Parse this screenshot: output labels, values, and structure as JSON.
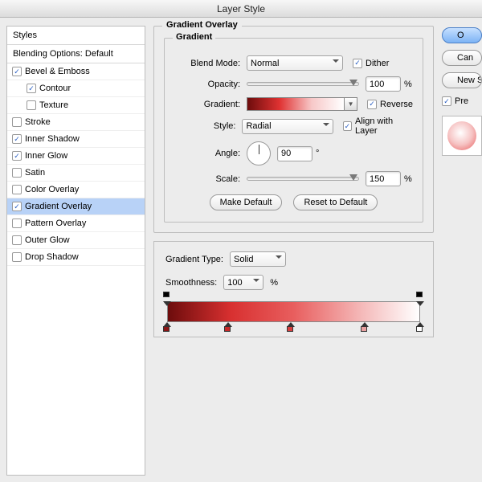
{
  "window_title": "Layer Style",
  "sidebar": {
    "heading1": "Styles",
    "heading2": "Blending Options: Default",
    "items": [
      {
        "label": "Bevel & Emboss",
        "checked": true,
        "indent": false
      },
      {
        "label": "Contour",
        "checked": true,
        "indent": true
      },
      {
        "label": "Texture",
        "checked": false,
        "indent": true
      },
      {
        "label": "Stroke",
        "checked": false,
        "indent": false
      },
      {
        "label": "Inner Shadow",
        "checked": true,
        "indent": false
      },
      {
        "label": "Inner Glow",
        "checked": true,
        "indent": false
      },
      {
        "label": "Satin",
        "checked": false,
        "indent": false
      },
      {
        "label": "Color Overlay",
        "checked": false,
        "indent": false
      },
      {
        "label": "Gradient Overlay",
        "checked": true,
        "indent": false,
        "selected": true
      },
      {
        "label": "Pattern Overlay",
        "checked": false,
        "indent": false
      },
      {
        "label": "Outer Glow",
        "checked": false,
        "indent": false
      },
      {
        "label": "Drop Shadow",
        "checked": false,
        "indent": false
      }
    ]
  },
  "main": {
    "title": "Gradient Overlay",
    "subtitle": "Gradient",
    "labels": {
      "blend_mode": "Blend Mode:",
      "opacity": "Opacity:",
      "gradient": "Gradient:",
      "style": "Style:",
      "angle": "Angle:",
      "scale": "Scale:",
      "dither": "Dither",
      "reverse": "Reverse",
      "align": "Align with Layer"
    },
    "values": {
      "blend_mode": "Normal",
      "opacity": "100",
      "style": "Radial",
      "angle": "90",
      "scale": "150",
      "dither_checked": true,
      "reverse_checked": true,
      "align_checked": true
    },
    "percent": "%",
    "degree": "°",
    "buttons": {
      "make_default": "Make Default",
      "reset_default": "Reset to Default"
    }
  },
  "right": {
    "ok_partial": "O",
    "cancel_partial": "Can",
    "newstyle_partial": "New S",
    "preview_partial": "Pre",
    "preview_checked": true
  },
  "grad_editor": {
    "type_label": "Gradient Type:",
    "type_value": "Solid",
    "smooth_label": "Smoothness:",
    "smooth_value": "100",
    "percent": "%",
    "opacity_stops": [
      0,
      100
    ],
    "color_stops": [
      {
        "pos": 0,
        "color": "#8a1515"
      },
      {
        "pos": 24,
        "color": "#c82828"
      },
      {
        "pos": 49,
        "color": "#d84040"
      },
      {
        "pos": 78,
        "color": "#e9a0a0"
      },
      {
        "pos": 100,
        "color": "#ffffff"
      }
    ]
  }
}
